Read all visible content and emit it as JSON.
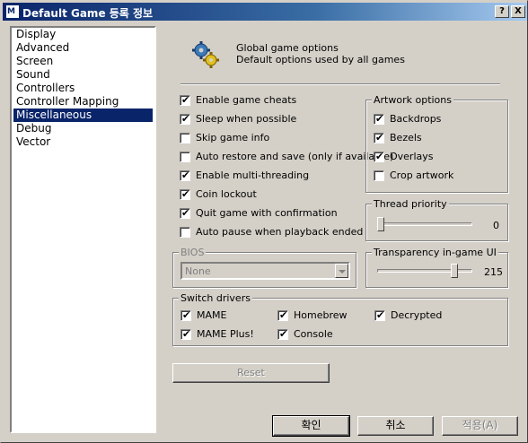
{
  "window": {
    "title": "Default Game 등록 정보",
    "app_icon_text": "M",
    "help_button": "?",
    "close_button": "X"
  },
  "sidebar": {
    "items": [
      {
        "label": "Display",
        "selected": false
      },
      {
        "label": "Advanced",
        "selected": false
      },
      {
        "label": "Screen",
        "selected": false
      },
      {
        "label": "Sound",
        "selected": false
      },
      {
        "label": "Controllers",
        "selected": false
      },
      {
        "label": "Controller Mapping",
        "selected": false
      },
      {
        "label": "Miscellaneous",
        "selected": true
      },
      {
        "label": "Debug",
        "selected": false
      },
      {
        "label": "Vector",
        "selected": false
      }
    ]
  },
  "header": {
    "icon": "gears-icon",
    "line1": "Global game options",
    "line2": "Default options used by all games"
  },
  "options": [
    {
      "label": "Enable game cheats",
      "checked": true
    },
    {
      "label": "Sleep when possible",
      "checked": true
    },
    {
      "label": "Skip game info",
      "checked": false
    },
    {
      "label": "Auto restore and save (only if available)",
      "checked": false
    },
    {
      "label": "Enable multi-threading",
      "checked": true
    },
    {
      "label": "Coin lockout",
      "checked": true
    },
    {
      "label": "Quit game with confirmation",
      "checked": true
    },
    {
      "label": "Auto pause when playback ended",
      "checked": false
    }
  ],
  "artwork": {
    "title": "Artwork options",
    "items": [
      {
        "label": "Backdrops",
        "checked": true
      },
      {
        "label": "Bezels",
        "checked": true
      },
      {
        "label": "Overlays",
        "checked": true
      },
      {
        "label": "Crop artwork",
        "checked": false
      }
    ]
  },
  "thread_priority": {
    "title": "Thread priority",
    "value": "0",
    "level": 0
  },
  "transparency": {
    "title": "Transparency in-game UI",
    "value": "215",
    "level": 0.843
  },
  "bios": {
    "title": "BIOS",
    "selected": "None"
  },
  "switch_drivers": {
    "title": "Switch drivers",
    "items": [
      {
        "label": "MAME",
        "checked": true
      },
      {
        "label": "Homebrew",
        "checked": true
      },
      {
        "label": "Decrypted",
        "checked": true
      },
      {
        "label": "MAME Plus!",
        "checked": true
      },
      {
        "label": "Console",
        "checked": true
      }
    ]
  },
  "buttons": {
    "reset": "Reset",
    "ok": "확인",
    "cancel": "취소",
    "apply": "적용(A)"
  },
  "check_mark": "✔"
}
